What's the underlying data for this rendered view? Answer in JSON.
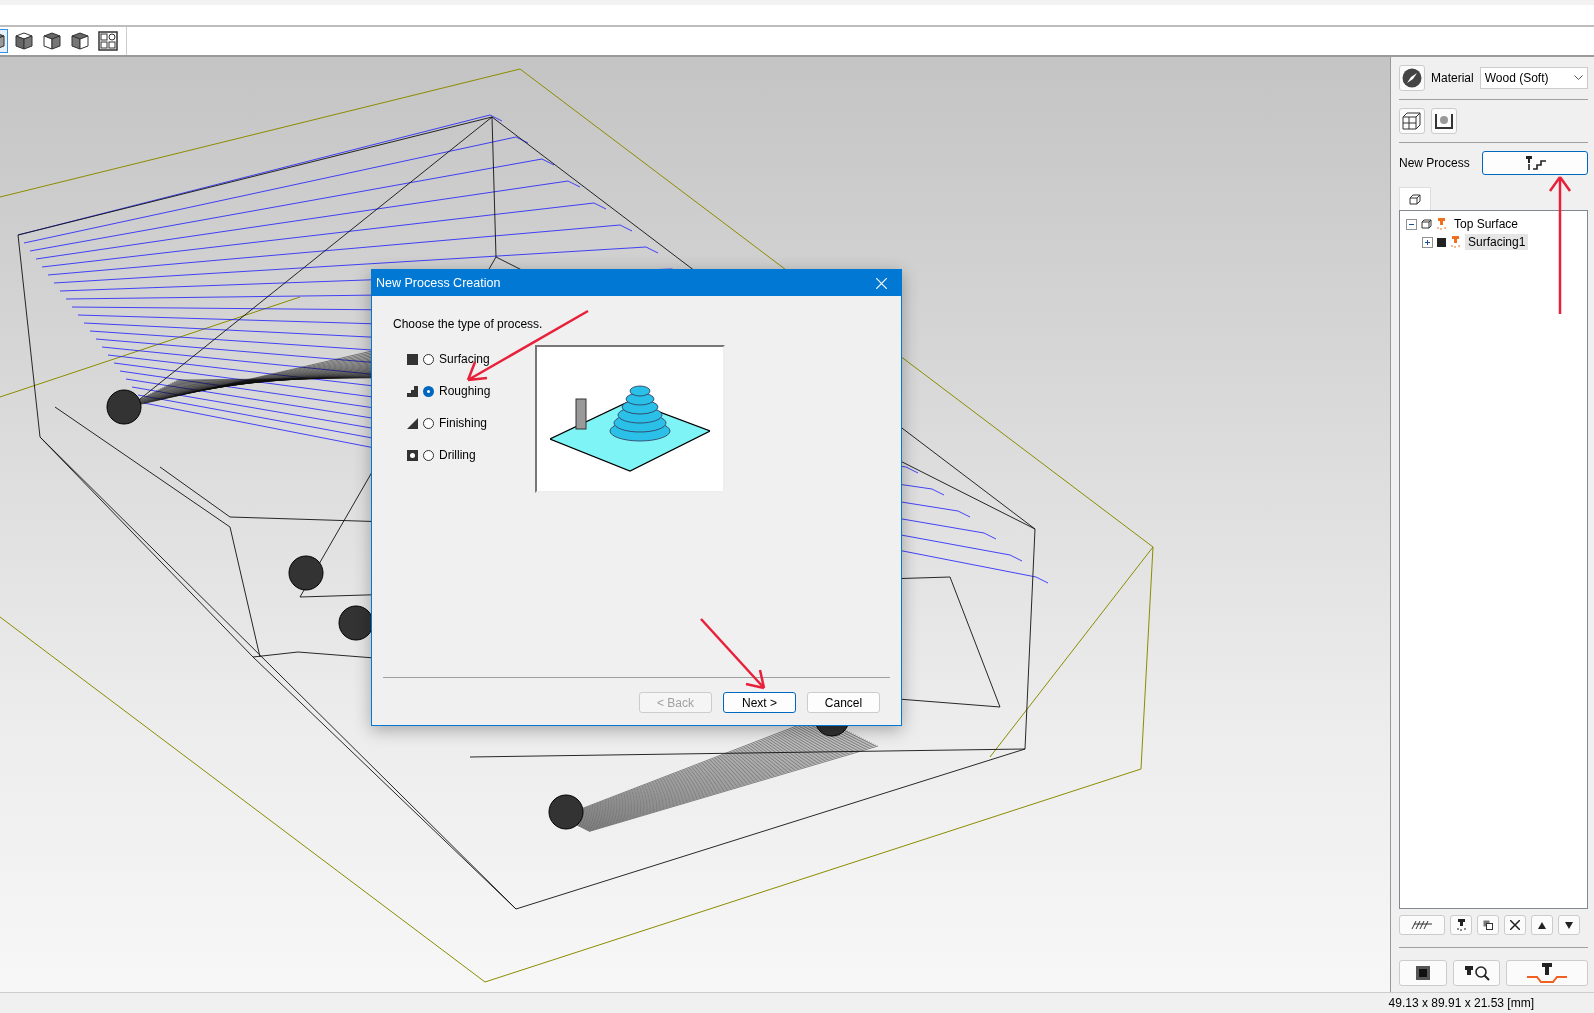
{
  "toolbar": {
    "view_buttons": [
      {
        "kind": "iso",
        "selected": true
      },
      {
        "kind": "top",
        "selected": false
      },
      {
        "kind": "front",
        "selected": false
      },
      {
        "kind": "side",
        "selected": false
      },
      {
        "kind": "quad",
        "selected": false
      }
    ]
  },
  "right_panel": {
    "material_label": "Material",
    "material_value": "Wood (Soft)",
    "new_process_label": "New Process",
    "tree": [
      {
        "label": "Top Surface",
        "expanded": true,
        "selected": false,
        "children": [
          {
            "label": "Surfacing1",
            "expanded": false,
            "selected": true
          }
        ]
      }
    ]
  },
  "dialog": {
    "title": "New Process Creation",
    "prompt": "Choose the type of process.",
    "options": [
      {
        "kind": "surfacing",
        "label": "Surfacing",
        "selected": false
      },
      {
        "kind": "roughing",
        "label": "Roughing",
        "selected": true
      },
      {
        "kind": "finishing",
        "label": "Finishing",
        "selected": false
      },
      {
        "kind": "drilling",
        "label": "Drilling",
        "selected": false
      }
    ],
    "buttons": [
      {
        "label": "< Back",
        "disabled": true,
        "focused": false
      },
      {
        "label": "Next >",
        "disabled": false,
        "focused": true
      },
      {
        "label": "Cancel",
        "disabled": false,
        "focused": false
      }
    ]
  },
  "status_bar": {
    "dimensions": "49.13 x 89.91 x 21.53 [mm]"
  }
}
